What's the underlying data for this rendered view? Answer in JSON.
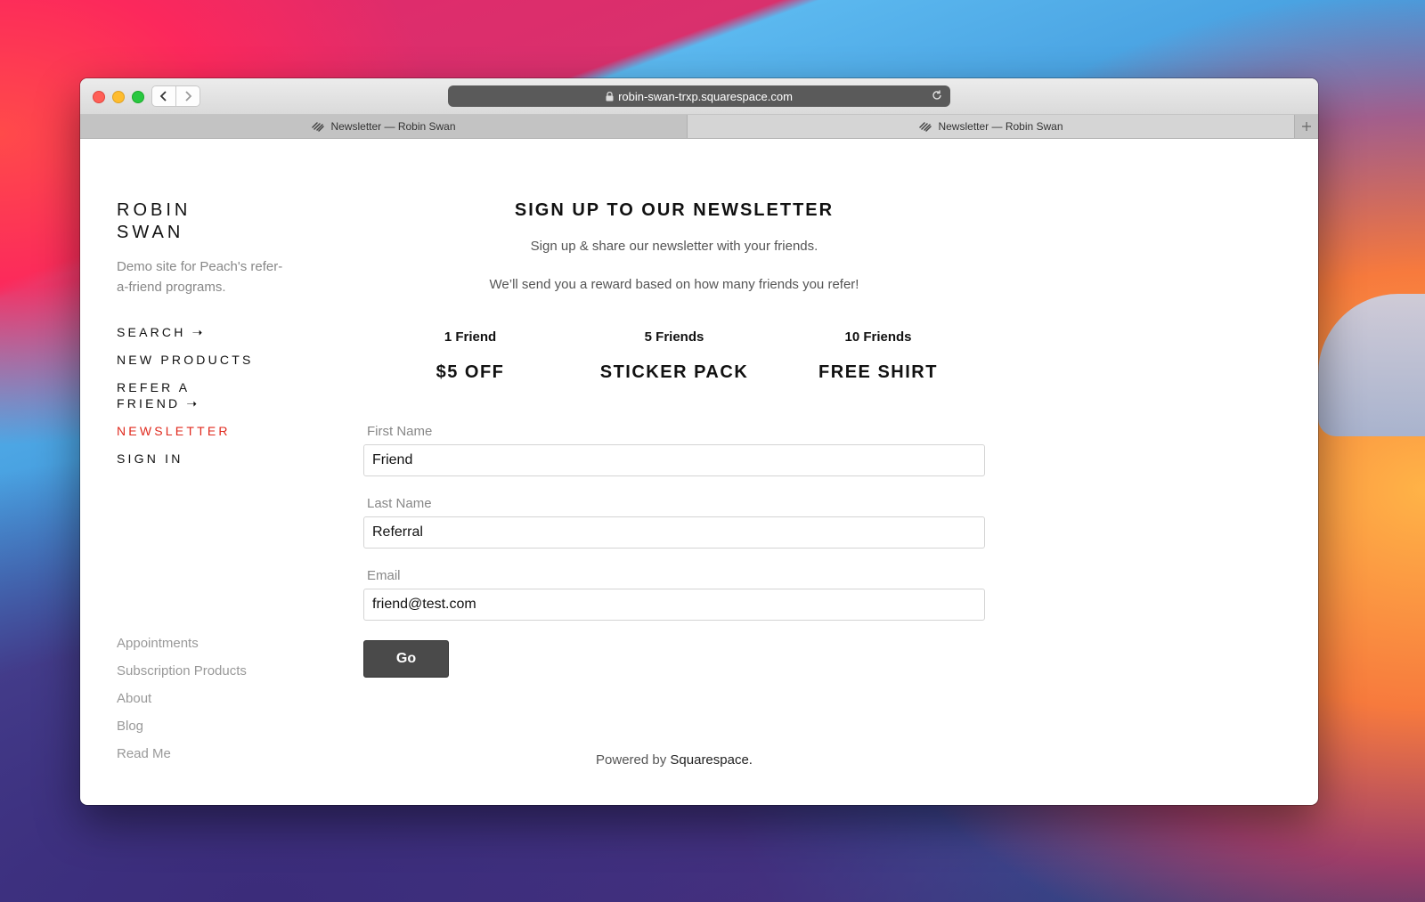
{
  "browser": {
    "url": "robin-swan-trxp.squarespace.com",
    "tabs": [
      {
        "label": "Newsletter — Robin Swan"
      },
      {
        "label": "Newsletter — Robin Swan"
      }
    ]
  },
  "site": {
    "brand_line1": "ROBIN",
    "brand_line2": "SWAN",
    "tagline": "Demo site for Peach's refer-a-friend programs."
  },
  "nav": {
    "items": [
      {
        "label": "SEARCH ➝"
      },
      {
        "label": "NEW PRODUCTS"
      },
      {
        "label": "REFER A"
      },
      {
        "label": "FRIEND ➝"
      },
      {
        "label": "NEWSLETTER"
      },
      {
        "label": "SIGN IN"
      }
    ],
    "active_color": "#e02a1e"
  },
  "footer_nav": {
    "items": [
      {
        "label": "Appointments"
      },
      {
        "label": "Subscription Products"
      },
      {
        "label": "About"
      },
      {
        "label": "Blog"
      },
      {
        "label": "Read Me"
      }
    ]
  },
  "main": {
    "heading": "SIGN UP TO OUR NEWSLETTER",
    "sub1": "Sign up & share our newsletter with your friends.",
    "sub2": "We’ll send you a reward based on how many friends you refer!",
    "tiers": [
      {
        "count": "1 Friend",
        "reward": "$5 OFF"
      },
      {
        "count": "5 Friends",
        "reward": "STICKER PACK"
      },
      {
        "count": "10 Friends",
        "reward": "FREE SHIRT"
      }
    ]
  },
  "form": {
    "first_name_label": "First Name",
    "first_name_value": "Friend",
    "last_name_label": "Last Name",
    "last_name_value": "Referral",
    "email_label": "Email",
    "email_value": "friend@test.com",
    "submit_label": "Go"
  },
  "footer": {
    "powered_prefix": "Powered by",
    "powered_link": "Squarespace."
  }
}
